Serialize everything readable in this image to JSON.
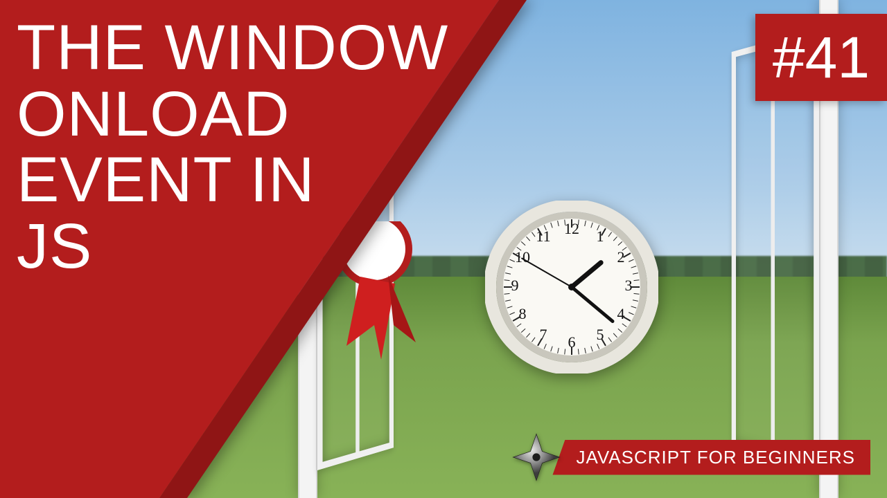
{
  "title_lines": [
    "THE WINDOW",
    "ONLOAD",
    "EVENT IN",
    "JS"
  ],
  "episode_badge": "#41",
  "subtitle": "JAVASCRIPT FOR BEGINNERS",
  "colors": {
    "red": "#b31d1d",
    "white": "#ffffff"
  },
  "clock": {
    "numerals": [
      "12",
      "1",
      "2",
      "3",
      "4",
      "5",
      "6",
      "7",
      "8",
      "9",
      "10",
      "11"
    ],
    "hour_hand_angle_deg": 50,
    "minute_hand_angle_deg": 130,
    "second_hand_angle_deg": 300
  },
  "icons": {
    "star": "ninja-star-icon",
    "clock": "clock-icon",
    "ribbon": "award-ribbon-icon"
  }
}
